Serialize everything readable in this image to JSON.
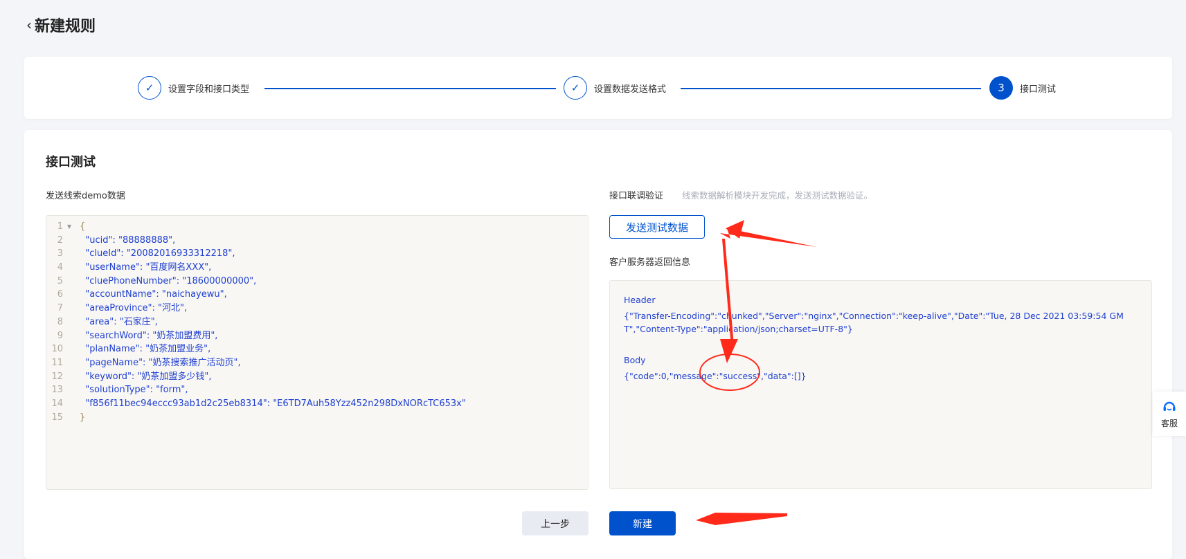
{
  "header": {
    "title": "新建规则"
  },
  "steps": [
    {
      "label": "设置字段和接口类型",
      "status": "done"
    },
    {
      "label": "设置数据发送格式",
      "status": "done"
    },
    {
      "label": "接口测试",
      "status": "active",
      "number": "3"
    }
  ],
  "section": {
    "title": "接口测试"
  },
  "demo": {
    "label": "发送线索demo数据",
    "lines": [
      {
        "n": "1",
        "text": "{"
      },
      {
        "n": "2",
        "text": "  \"ucid\": \"88888888\","
      },
      {
        "n": "3",
        "text": "  \"clueId\": \"20082016933312218\","
      },
      {
        "n": "4",
        "text": "  \"userName\": \"百度网名XXX\","
      },
      {
        "n": "5",
        "text": "  \"cluePhoneNumber\": \"18600000000\","
      },
      {
        "n": "6",
        "text": "  \"accountName\": \"naichayewu\","
      },
      {
        "n": "7",
        "text": "  \"areaProvince\": \"河北\","
      },
      {
        "n": "8",
        "text": "  \"area\": \"石家庄\","
      },
      {
        "n": "9",
        "text": "  \"searchWord\": \"奶茶加盟费用\","
      },
      {
        "n": "10",
        "text": "  \"planName\": \"奶茶加盟业务\","
      },
      {
        "n": "11",
        "text": "  \"pageName\": \"奶茶搜索推广活动页\","
      },
      {
        "n": "12",
        "text": "  \"keyword\": \"奶茶加盟多少钱\","
      },
      {
        "n": "13",
        "text": "  \"solutionType\": \"form\","
      },
      {
        "n": "14",
        "text": "  \"f856f11bec94eccc93ab1d2c25eb8314\": \"E6TD7Auh58Yzz452n298DxNORcTC653x\""
      },
      {
        "n": "15",
        "text": "}"
      }
    ]
  },
  "verify": {
    "label": "接口联调验证",
    "hint": "线索数据解析模块开发完成，发送测试数据验证。",
    "send_button": "发送测试数据",
    "response_label": "客户服务器返回信息",
    "header_title": "Header",
    "header_json": "{\"Transfer-Encoding\":\"chunked\",\"Server\":\"nginx\",\"Connection\":\"keep-alive\",\"Date\":\"Tue, 28 Dec 2021 03:59:54 GMT\",\"Content-Type\":\"application/json;charset=UTF-8\"}",
    "body_title": "Body",
    "body_json": "{\"code\":0,\"message\":\"success\",\"data\":[]}"
  },
  "footer": {
    "prev": "上一步",
    "create": "新建"
  },
  "support": {
    "label": "客服"
  },
  "colors": {
    "primary": "#0052cc",
    "annotation": "#ff2a1a"
  }
}
